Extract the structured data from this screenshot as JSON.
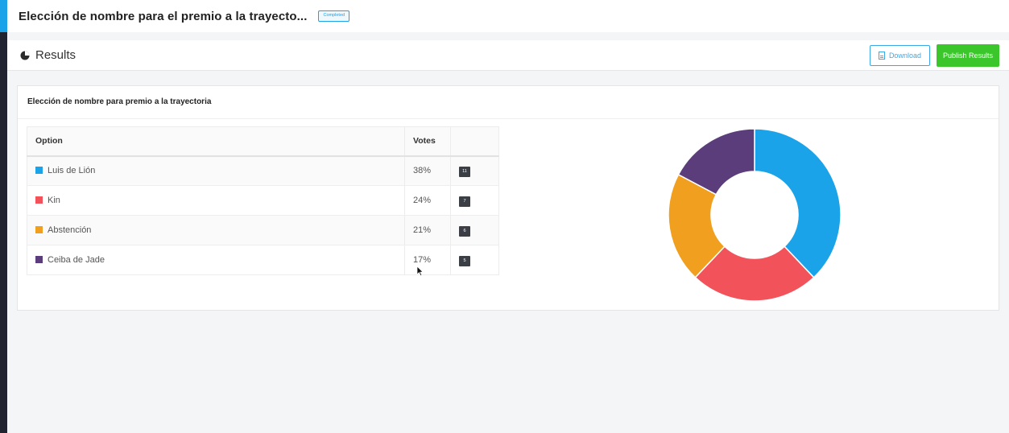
{
  "header": {
    "title": "Elección de nombre para el premio a la trayecto...",
    "status_badge": "Completed"
  },
  "results_bar": {
    "label": "Results",
    "icon": "pie-chart-icon",
    "download_label": "Download",
    "download_icon": "document-icon",
    "publish_label": "Publish Results"
  },
  "panel": {
    "title": "Elección de nombre para premio a la trayectoria",
    "columns": {
      "option": "Option",
      "votes": "Votes"
    },
    "rows": [
      {
        "label": "Luis de Lión",
        "percent": "38%",
        "count": "11",
        "color": "#1aa3e8"
      },
      {
        "label": "Kin",
        "percent": "24%",
        "count": "7",
        "color": "#f25259"
      },
      {
        "label": "Abstención",
        "percent": "21%",
        "count": "6",
        "color": "#f0a01e"
      },
      {
        "label": "Ceiba de Jade",
        "percent": "17%",
        "count": "5",
        "color": "#5a3d7a"
      }
    ]
  },
  "chart_data": {
    "type": "pie",
    "style": "donut",
    "categories": [
      "Luis de Lión",
      "Kin",
      "Abstención",
      "Ceiba de Jade"
    ],
    "values": [
      11,
      7,
      6,
      5
    ],
    "colors": [
      "#1aa3e8",
      "#f25259",
      "#f0a01e",
      "#5a3d7a"
    ],
    "legend": "none",
    "title": ""
  },
  "colors": {
    "accent": "#1aa3e8",
    "publish": "#3bc72b",
    "sidebar": "#1f2430"
  }
}
